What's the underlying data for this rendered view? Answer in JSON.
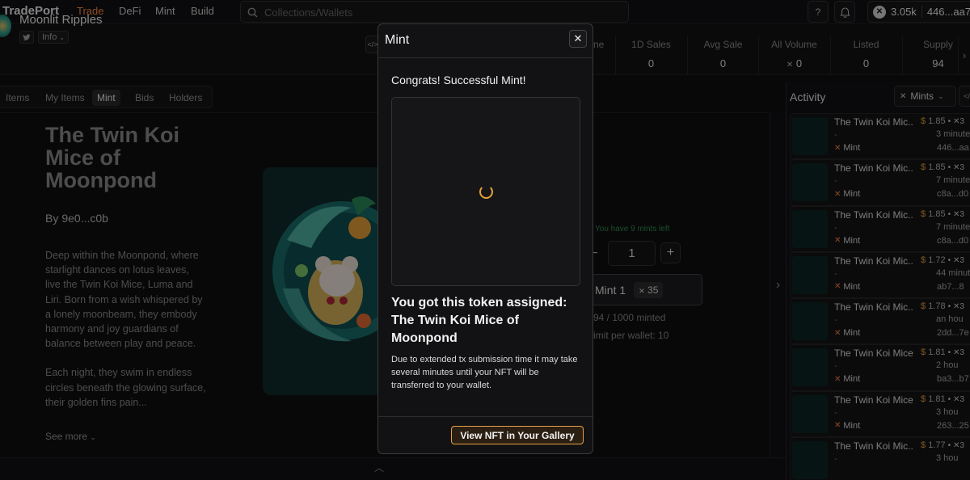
{
  "nav": {
    "logo": "TradePort",
    "links": [
      "Trade",
      "DeFi",
      "Mint",
      "Build"
    ],
    "search_placeholder": "Collections/Wallets",
    "help_icon": "?",
    "balance": "3.05k",
    "wallet": "446...aa7"
  },
  "collection": {
    "name": "Moonlit Ripples",
    "info_label": "Info",
    "stats": [
      {
        "label": "1D Sales",
        "value": "0"
      },
      {
        "label": "Avg Sale",
        "value": "0"
      },
      {
        "label": "All Volume",
        "value": "0"
      },
      {
        "label": "Listed",
        "value": "0"
      },
      {
        "label": "Supply",
        "value": "94"
      }
    ],
    "cut_label": "ne"
  },
  "tabs": [
    "Items",
    "My Items",
    "Mint",
    "Bids",
    "Holders"
  ],
  "nft": {
    "title": "The Twin Koi Mice of Moonpond",
    "by_label": "By",
    "creator": "9e0...c0b",
    "description": [
      "Deep within the Moonpond, where starlight dances on lotus leaves, live the Twin Koi Mice, Luma and Liri. Born from a wish whispered by a lonely moonbeam, they embody harmony and joy guardians of balance between play and peace.",
      "Each night, they swim in endless circles beneath the glowing surface, their golden fins pain..."
    ],
    "see_more": "See more"
  },
  "mint_panel": {
    "mints_left": "You have 9 mints left",
    "quantity": "1",
    "button_label": "Mint 1",
    "button_price": "35",
    "minted": "94 / 1000 minted",
    "limit": "imit per wallet: 10"
  },
  "activity": {
    "title": "Activity",
    "filter": "Mints",
    "rows": [
      {
        "name": "The Twin Koi Mic...",
        "price": "1.85",
        "time": "3 minute",
        "addr": "446...aa",
        "type": "Mint"
      },
      {
        "name": "The Twin Koi Mic...",
        "price": "1.85",
        "time": "7 minute",
        "addr": "c8a...d0",
        "type": "Mint"
      },
      {
        "name": "The Twin Koi Mic...",
        "price": "1.85",
        "time": "7 minute",
        "addr": "c8a...d0",
        "type": "Mint"
      },
      {
        "name": "The Twin Koi Mic...",
        "price": "1.72",
        "time": "44 minute",
        "addr": "ab7...8",
        "type": "Mint"
      },
      {
        "name": "The Twin Koi Mic...",
        "price": "1.78",
        "time": "an hou",
        "addr": "2dd...7e",
        "type": "Mint"
      },
      {
        "name": "The Twin Koi Mice...",
        "price": "1.81",
        "time": "2 hou",
        "addr": "ba3...b7",
        "type": "Mint"
      },
      {
        "name": "The Twin Koi Mice...",
        "price": "1.81",
        "time": "3 hou",
        "addr": "263...25",
        "type": "Mint"
      },
      {
        "name": "The Twin Koi Mic...",
        "price": "1.77",
        "time": "3 hou",
        "addr": "",
        "type": ""
      }
    ]
  },
  "modal": {
    "title": "Mint",
    "congrats": "Congrats! Successful Mint!",
    "assigned_heading": "You got this token assigned: The Twin Koi Mice of Moonpond",
    "notice": "Due to extended tx submission time it may take several minutes until your NFT will be transferred to your wallet.",
    "gallery_button": "View NFT in Your Gallery"
  },
  "colors": {
    "accent": "#ff8a3d",
    "gallery_border": "#e8a045",
    "spinner": "#e6a13a",
    "mints_left": "#2f8f4e"
  }
}
